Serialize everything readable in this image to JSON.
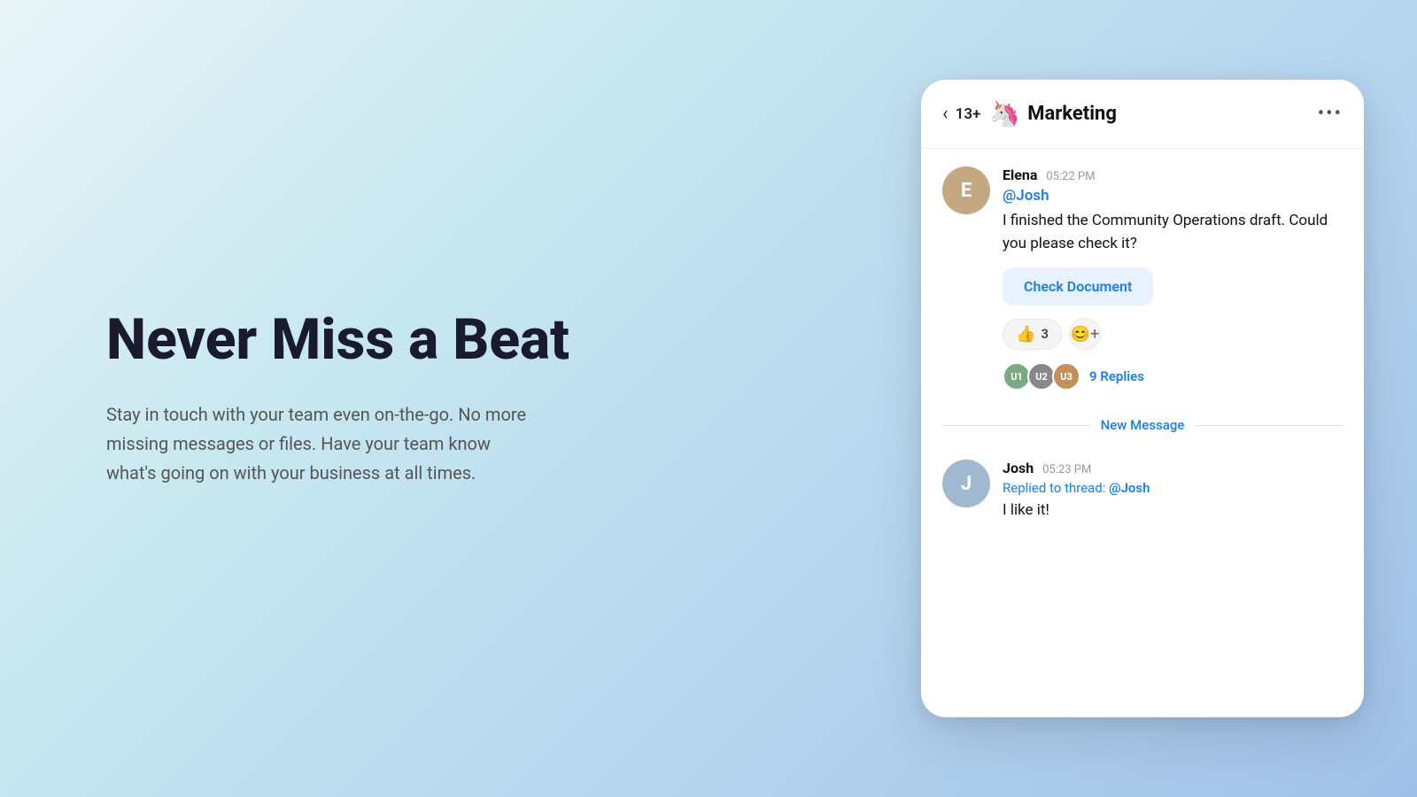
{
  "left": {
    "title": "Never Miss a Beat",
    "subtitle": "Stay in touch with your team even on-the-go. No more missing messages or files. Have your team know what's going on with your business at all times."
  },
  "chat": {
    "header": {
      "back_icon": "‹",
      "member_count": "13+",
      "channel_emoji": "🦄",
      "channel_name": "Marketing",
      "more_icon": "•••"
    },
    "messages": [
      {
        "id": "msg1",
        "sender": "Elena",
        "time": "05:22 PM",
        "mention": "@Josh",
        "text": "I finished the Community Operations draft. Could you please check it?",
        "doc_button": "Check Document",
        "reactions": [
          {
            "emoji": "👍",
            "count": "3"
          }
        ],
        "reply_count": "9 Replies",
        "reply_avatars": [
          "u1",
          "u2",
          "u3"
        ]
      }
    ],
    "divider": "New Message",
    "second_message": {
      "sender": "Josh",
      "time": "05:23 PM",
      "replied_to_prefix": "Replied to thread:",
      "replied_to_mention": "@Josh",
      "text": "I like it!"
    }
  },
  "colors": {
    "accent": "#1a7fe8",
    "title_dark": "#1a1a2e",
    "subtitle_gray": "#555",
    "message_text": "#111"
  }
}
